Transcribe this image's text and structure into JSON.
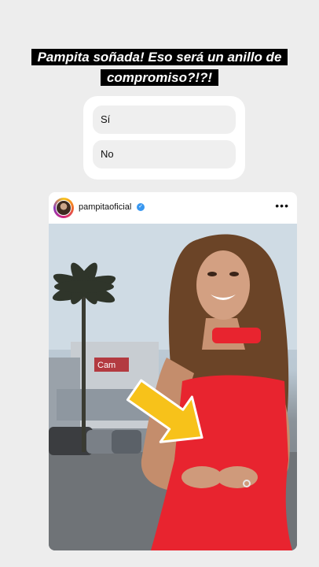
{
  "headline": {
    "line1": "Pampita soñada! Eso será un anillo de",
    "line2": "compromiso?!?!"
  },
  "poll": {
    "options": [
      {
        "label": "Sí"
      },
      {
        "label": "No"
      }
    ]
  },
  "post": {
    "username": "pampitaoficial",
    "more_icon": "more-horizontal-icon",
    "verified_icon": "verified-badge-icon",
    "sign_text": "Cam"
  },
  "colors": {
    "background": "#ededed",
    "dress": "#e8242f",
    "arrow": "#f7c21a",
    "verified": "#3897f0"
  }
}
